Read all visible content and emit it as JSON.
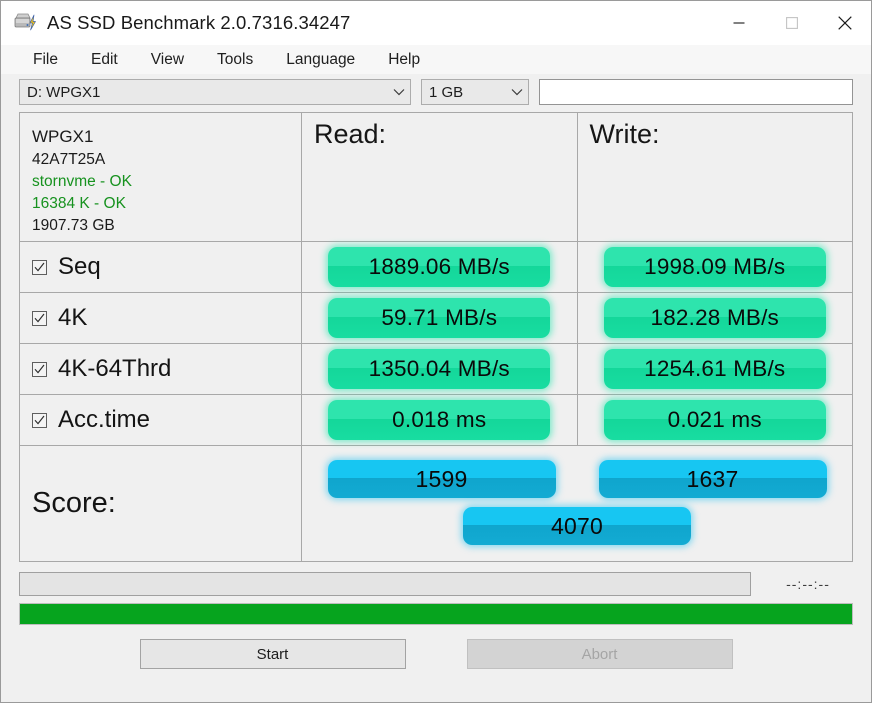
{
  "window": {
    "title": "AS SSD Benchmark 2.0.7316.34247",
    "app_icon": "hard-drive-icon",
    "minimize_label": "—",
    "maximize_label": "□",
    "close_label": "✕"
  },
  "menu": {
    "items": [
      {
        "label": "File"
      },
      {
        "label": "Edit"
      },
      {
        "label": "View"
      },
      {
        "label": "Tools"
      },
      {
        "label": "Language"
      },
      {
        "label": "Help"
      }
    ]
  },
  "toolbar": {
    "drive_select": "D: WPGX1",
    "size_select": "1 GB",
    "note_value": "",
    "note_placeholder": ""
  },
  "device": {
    "name": "WPGX1",
    "firmware": "42A7T25A",
    "driver": "stornvme - OK",
    "alignment": "16384 K - OK",
    "capacity": "1907.73 GB"
  },
  "columns": {
    "read": "Read:",
    "write": "Write:"
  },
  "tests": [
    {
      "label": "Seq",
      "checked": true,
      "read": "1889.06 MB/s",
      "write": "1998.09 MB/s"
    },
    {
      "label": "4K",
      "checked": true,
      "read": "59.71 MB/s",
      "write": "182.28 MB/s"
    },
    {
      "label": "4K-64Thrd",
      "checked": true,
      "read": "1350.04 MB/s",
      "write": "1254.61 MB/s"
    },
    {
      "label": "Acc.time",
      "checked": true,
      "read": "0.018 ms",
      "write": "0.021 ms"
    }
  ],
  "score": {
    "title": "Score:",
    "read": "1599",
    "write": "1637",
    "total": "4070"
  },
  "status": {
    "message": "",
    "timer": "--:--:--",
    "progress_percent": 100
  },
  "buttons": {
    "start": "Start",
    "abort": "Abort"
  },
  "colors": {
    "badge_green_top": "#2ee4ad",
    "badge_green_bottom": "#14d79a",
    "badge_blue_top": "#17c6f2",
    "badge_blue_bottom": "#0fa5cd",
    "progress_green": "#06a41e",
    "ok_text_green": "#17921f"
  }
}
